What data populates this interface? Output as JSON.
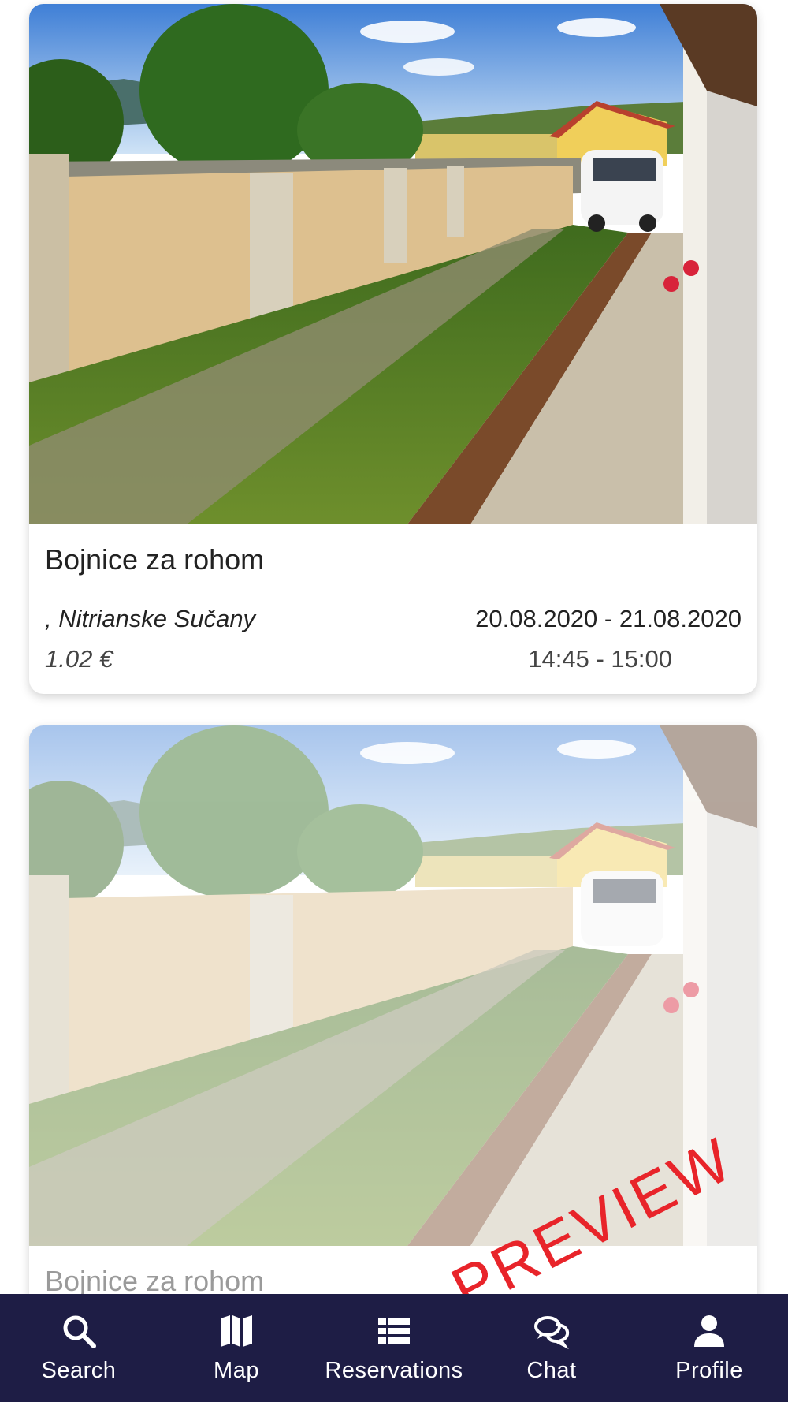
{
  "listings": [
    {
      "title": "Bojnice za rohom",
      "location": ", Nitrianske Sučany",
      "price": "1.02 €",
      "dates": "20.08.2020 - 21.08.2020",
      "times": "14:45 - 15:00"
    },
    {
      "title": "Bojnice za rohom"
    }
  ],
  "watermark": "PREVIEW",
  "nav": {
    "items": [
      {
        "label": "Search",
        "icon": "search-icon"
      },
      {
        "label": "Map",
        "icon": "map-icon"
      },
      {
        "label": "Reservations",
        "icon": "list-icon"
      },
      {
        "label": "Chat",
        "icon": "chat-icon"
      },
      {
        "label": "Profile",
        "icon": "person-icon"
      }
    ]
  },
  "colors": {
    "nav_background": "#1e1d45",
    "watermark": "#e8242a"
  }
}
